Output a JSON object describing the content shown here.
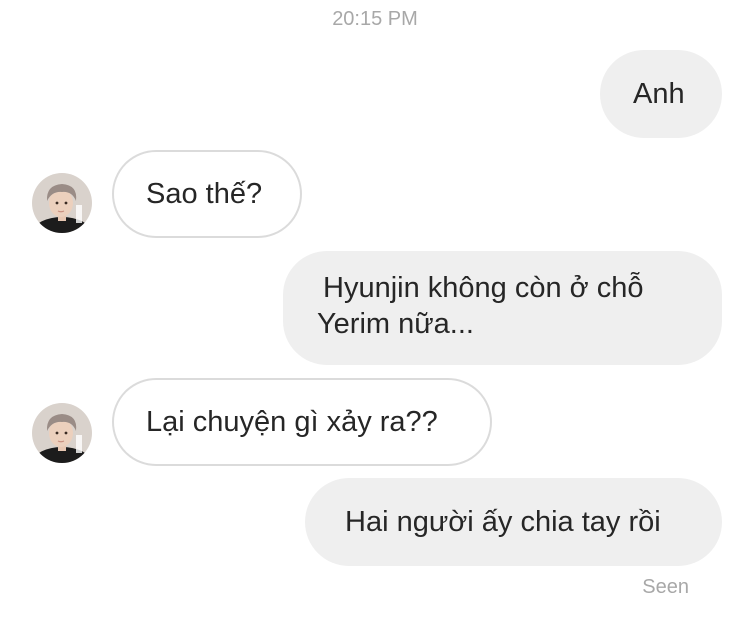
{
  "timestamp": "20:15 PM",
  "messages": [
    {
      "sender": "me",
      "text": "Anh"
    },
    {
      "sender": "them",
      "text": "Sao thế?"
    },
    {
      "sender": "me",
      "line1": "Hyunjin không còn ở chỗ",
      "line2": "Yerim nữa..."
    },
    {
      "sender": "them",
      "text": "Lại chuyện gì xảy ra??"
    },
    {
      "sender": "me",
      "text": "Hai người ấy chia tay rồi"
    }
  ],
  "status": "Seen",
  "colors": {
    "sent_bubble": "#efefef",
    "received_border": "#dbdbdb",
    "meta_text": "#a8a8a8",
    "message_text": "#262626"
  },
  "icons": {
    "contact_avatar": "avatar"
  }
}
